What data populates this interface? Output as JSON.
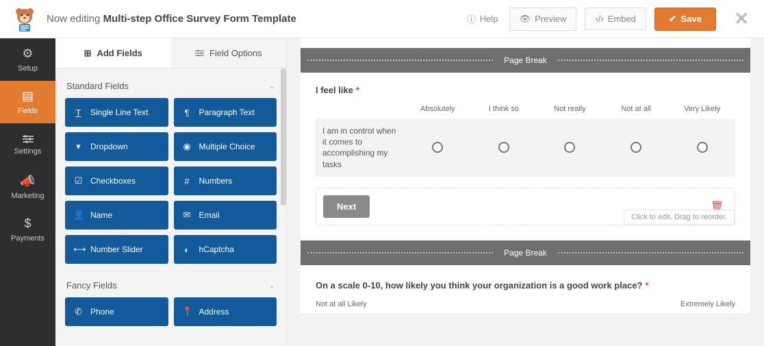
{
  "header": {
    "editing_prefix": "Now editing",
    "form_title": "Multi-step Office Survey Form Template",
    "help": "Help",
    "preview": "Preview",
    "embed": "Embed",
    "save": "Save"
  },
  "side_nav": [
    {
      "label": "Setup",
      "icon": "gear-icon"
    },
    {
      "label": "Fields",
      "icon": "form-icon",
      "active": true
    },
    {
      "label": "Settings",
      "icon": "sliders-icon"
    },
    {
      "label": "Marketing",
      "icon": "bullhorn-icon"
    },
    {
      "label": "Payments",
      "icon": "dollar-icon"
    }
  ],
  "panel": {
    "tabs": {
      "add": "Add Fields",
      "options": "Field Options"
    },
    "standard_heading": "Standard Fields",
    "fancy_heading": "Fancy Fields",
    "standard": [
      {
        "label": "Single Line Text",
        "icon": "text-icon"
      },
      {
        "label": "Paragraph Text",
        "icon": "paragraph-icon"
      },
      {
        "label": "Dropdown",
        "icon": "dropdown-icon"
      },
      {
        "label": "Multiple Choice",
        "icon": "target-icon"
      },
      {
        "label": "Checkboxes",
        "icon": "check-icon"
      },
      {
        "label": "Numbers",
        "icon": "hash-icon"
      },
      {
        "label": "Name",
        "icon": "user-icon"
      },
      {
        "label": "Email",
        "icon": "mail-icon"
      },
      {
        "label": "Number Slider",
        "icon": "slider-icon"
      },
      {
        "label": "hCaptcha",
        "icon": "captcha-icon"
      }
    ],
    "fancy": [
      {
        "label": "Phone",
        "icon": "phone-icon"
      },
      {
        "label": "Address",
        "icon": "pin-icon"
      }
    ]
  },
  "canvas": {
    "page_break": "Page Break",
    "q1": {
      "label": "I feel like",
      "columns": [
        "Absolutely",
        "I think so",
        "Not really",
        "Not at all",
        "Very Likely"
      ],
      "row_label": "I am in control when it comes to accomplishing my tasks",
      "next": "Next",
      "hint": "Click to edit. Drag to reorder."
    },
    "q2": {
      "label": "On a scale 0-10, how likely you think your organization is a good work place?",
      "left": "Not at all Likely",
      "right": "Extremely Likely"
    }
  }
}
